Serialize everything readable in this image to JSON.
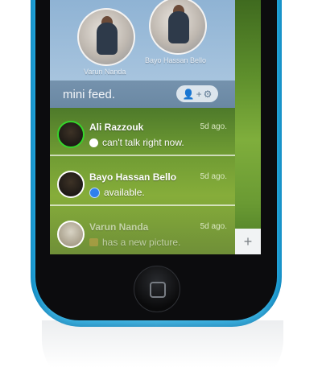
{
  "friends": [
    {
      "name": "Varun Nanda"
    },
    {
      "name": "Bayo Hassan Bello"
    }
  ],
  "feed_header": {
    "title": "mini feed.",
    "add_icon": "add-user-icon",
    "settings_icon": "gear-icon",
    "plus_symbol": "+"
  },
  "feed": [
    {
      "name": "Ali Razzouk",
      "time": "5d ago.",
      "status": "can't talk right now.",
      "status_icon": "chat-bubble-icon",
      "online_ring": "#36d62b"
    },
    {
      "name": "Bayo Hassan Bello",
      "time": "5d ago.",
      "status": "available.",
      "status_icon": "blue-dot-icon"
    },
    {
      "name": "Varun Nanda",
      "time": "5d ago.",
      "status": "has a new picture.",
      "status_icon": "picture-icon"
    }
  ],
  "side_panel": {
    "add_label": "+"
  },
  "colors": {
    "phone_body": "#3ec0f0",
    "accent_green": "#36d62b"
  }
}
